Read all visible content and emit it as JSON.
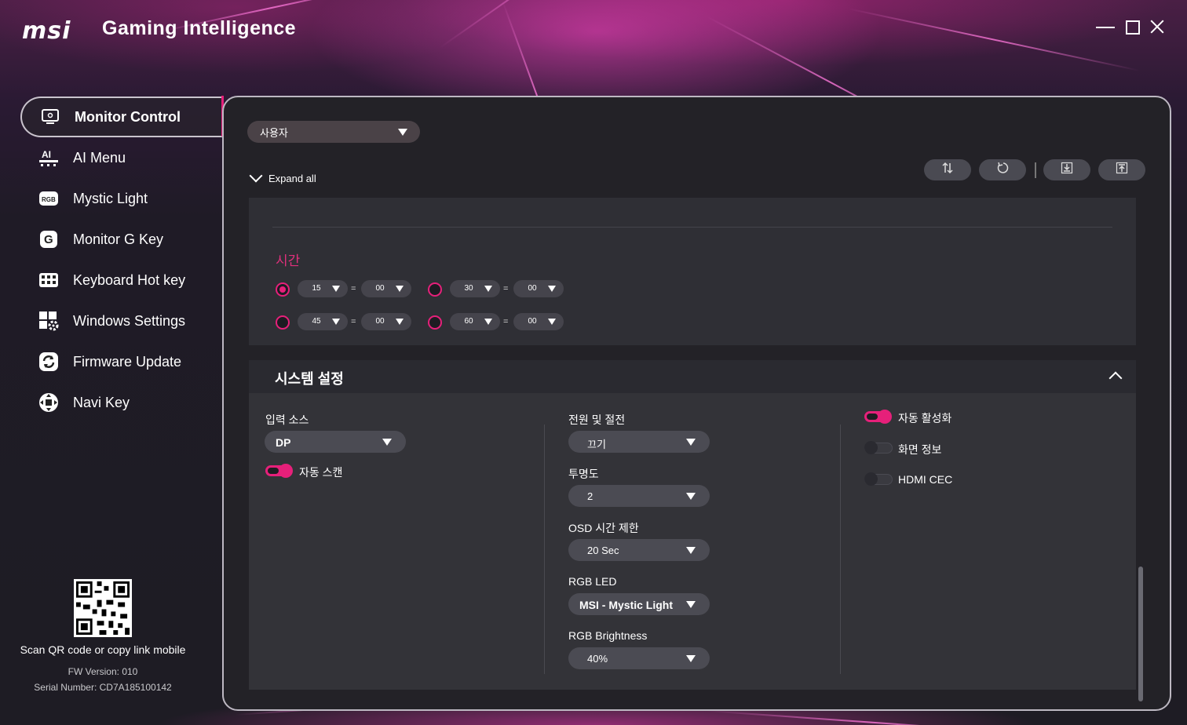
{
  "app": {
    "logo": "msi",
    "title": "Gaming Intelligence"
  },
  "window_controls": {
    "minimize_icon": "minimize-icon",
    "maximize_icon": "maximize-icon",
    "close_icon": "close-icon"
  },
  "sidebar": {
    "items": [
      {
        "label": "Monitor Control",
        "icon": "monitor-icon",
        "active": true
      },
      {
        "label": "AI Menu",
        "icon": "ai-icon"
      },
      {
        "label": "Mystic Light",
        "icon": "rgb-icon"
      },
      {
        "label": "Monitor G Key",
        "icon": "g-key-icon"
      },
      {
        "label": "Keyboard Hot key",
        "icon": "keyboard-icon"
      },
      {
        "label": "Windows Settings",
        "icon": "windows-settings-icon"
      },
      {
        "label": "Firmware Update",
        "icon": "firmware-update-icon"
      },
      {
        "label": "Navi Key",
        "icon": "navi-key-icon"
      }
    ],
    "qr_text": "Scan QR code or copy link mobile",
    "fw_version": "FW Version: 010",
    "serial": "Serial Number: CD7A185100142"
  },
  "main": {
    "profile": {
      "value": "사용자"
    },
    "expand_all": "Expand all",
    "toolbar": [
      "sort-icon",
      "reset-icon",
      "import-icon",
      "export-icon"
    ],
    "time_section": {
      "title": "시간",
      "rows": [
        {
          "selected": true,
          "first": "15",
          "second": "00"
        },
        {
          "selected": false,
          "first": "30",
          "second": "00"
        },
        {
          "selected": false,
          "first": "45",
          "second": "00"
        },
        {
          "selected": false,
          "first": "60",
          "second": "00"
        }
      ],
      "separator": "="
    },
    "system": {
      "title": "시스템 설정",
      "input_source_label": "입력 소스",
      "input_source_value": "DP",
      "auto_scan_label": "자동 스캔",
      "power_label": "전원 및 절전",
      "power_value": "끄기",
      "transparency_label": "투명도",
      "transparency_value": "2",
      "osd_timeout_label": "OSD 시간 제한",
      "osd_timeout_value": "20 Sec",
      "rgb_led_label": "RGB LED",
      "rgb_led_value": "MSI - Mystic Light",
      "rgb_brightness_label": "RGB Brightness",
      "rgb_brightness_value": "40%",
      "auto_activate_label": "자동 활성화",
      "screen_info_label": "화면 정보",
      "hdmi_cec_label": "HDMI CEC",
      "toggles": {
        "auto_scan": true,
        "auto_activate": true,
        "screen_info": false,
        "hdmi_cec": false
      }
    }
  },
  "colors": {
    "accent": "#e6207a",
    "panel": "#232227",
    "card": "#333338"
  }
}
